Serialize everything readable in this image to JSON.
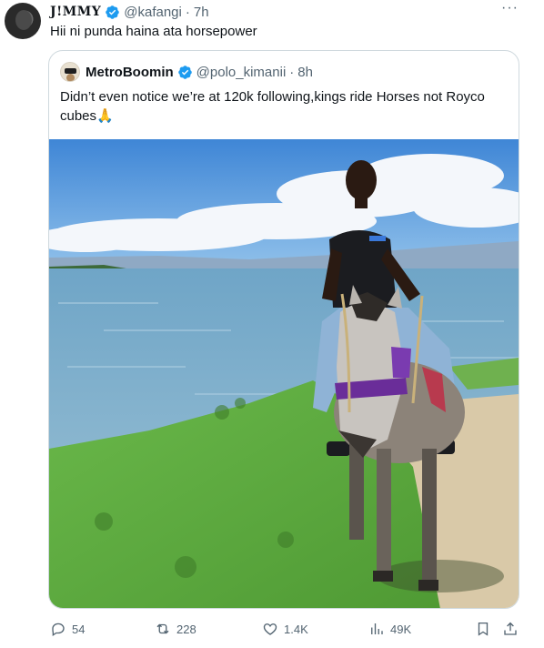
{
  "tweet": {
    "author_name": "J!MMY",
    "author_handle": "@kafangi",
    "time": "7h",
    "text": "Hii ni punda haina ata horsepower",
    "more_label": "···"
  },
  "quote": {
    "author_name": "MetroBoomin",
    "author_handle": "@polo_kimanii",
    "time": "8h",
    "text": "Didn’t even notice we’re at 120k following,kings ride Horses not Royco cubes🙏"
  },
  "actions": {
    "replies": "54",
    "reposts": "228",
    "likes": "1.4K",
    "views": "49K"
  },
  "colors": {
    "verified": "#1d9bf0",
    "secondary_text": "#536471",
    "border": "#cfd9de"
  },
  "icons": [
    "verified-badge-icon",
    "more-icon",
    "reply-icon",
    "repost-icon",
    "like-icon",
    "views-icon",
    "bookmark-icon",
    "share-icon"
  ]
}
